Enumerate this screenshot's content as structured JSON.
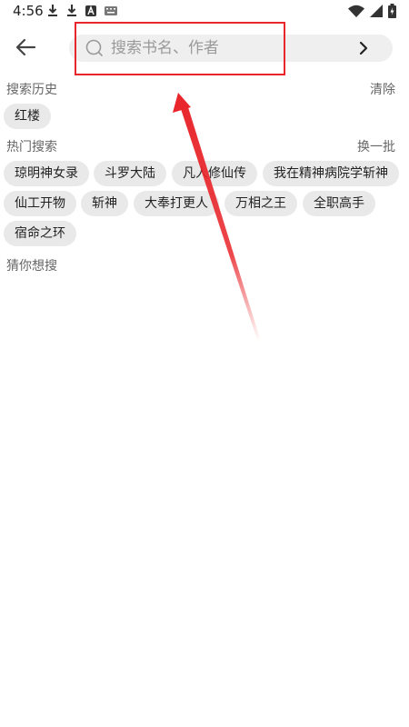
{
  "status_bar": {
    "time": "4:56",
    "left_icons": [
      "download-icon",
      "download-icon",
      "a-app-icon",
      "keyboard-icon"
    ],
    "right_icons": [
      "wifi-icon",
      "cell-signal-icon",
      "battery-icon"
    ]
  },
  "search": {
    "placeholder": "搜索书名、作者",
    "value": ""
  },
  "history": {
    "title": "搜索历史",
    "action": "清除",
    "tags": [
      "红楼"
    ]
  },
  "hot": {
    "title": "热门搜索",
    "action": "换一批",
    "tags": [
      "琼明神女录",
      "斗罗大陆",
      "凡人修仙传",
      "我在精神病院学斩神",
      "仙工开物",
      "斩神",
      "大奉打更人",
      "万相之王",
      "全职高手",
      "宿命之环"
    ]
  },
  "guess": {
    "title": "猜你想搜"
  },
  "colors": {
    "annotation_red": "#e8262b",
    "tag_background": "#e9e9e9",
    "search_background": "#efefef"
  }
}
